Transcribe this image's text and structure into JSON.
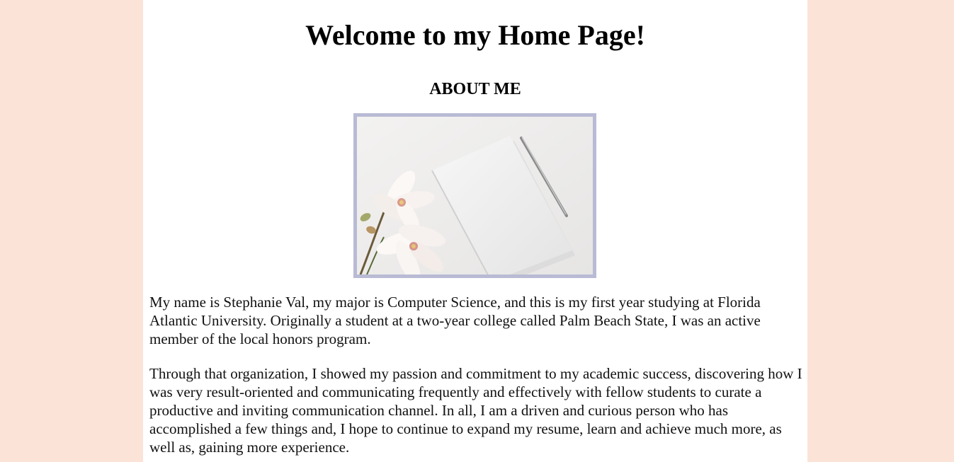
{
  "colors": {
    "background": "#fce3d8",
    "content_background": "#ffffff",
    "image_border": "#b9bad4"
  },
  "header": {
    "title": "Welcome to my Home Page!"
  },
  "about": {
    "heading": "ABOUT ME",
    "photo_icon": "notebook-flowers-photo-icon",
    "paragraphs": [
      "My name is Stephanie Val, my major is Computer Science, and this is my first year studying at Florida Atlantic University. Originally a student at a two-year college called Palm Beach State, I was an active member of the local honors program.",
      "Through that organization, I showed my passion and commitment to my academic success, discovering how I was very result-oriented and communicating frequently and effectively with fellow students to curate a productive and inviting communication channel. In all, I am a driven and curious person who has accomplished a few things and, I hope to continue to expand my resume, learn and achieve much more, as well as, gaining more experience."
    ]
  }
}
